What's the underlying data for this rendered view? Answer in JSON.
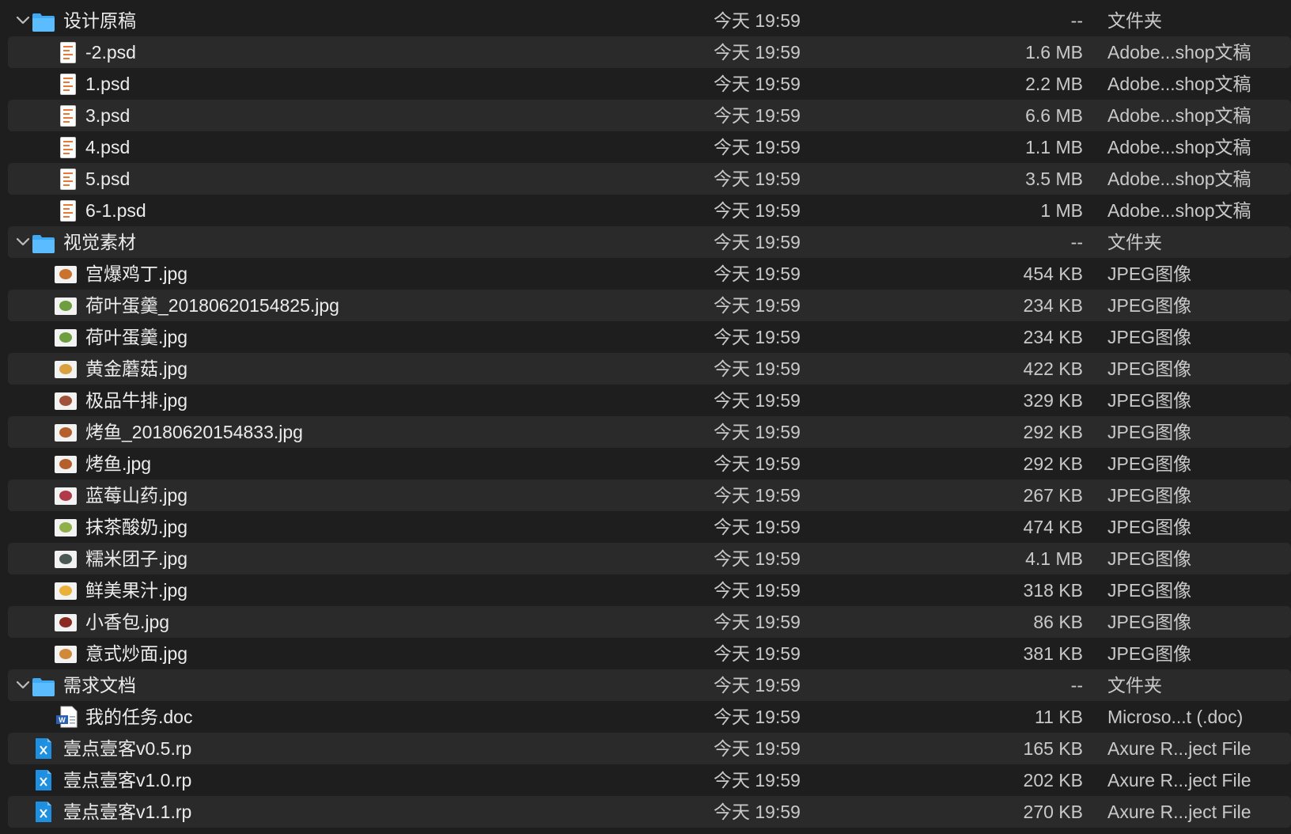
{
  "rows": [
    {
      "name": "设计原稿",
      "date": "今天 19:59",
      "size": "--",
      "kind": "文件夹",
      "icon": "folder-icon",
      "level": 0,
      "expanded": true
    },
    {
      "name": "-2.psd",
      "date": "今天 19:59",
      "size": "1.6 MB",
      "kind": "Adobe...shop文稿",
      "icon": "psd-file-icon",
      "level": 1
    },
    {
      "name": "1.psd",
      "date": "今天 19:59",
      "size": "2.2 MB",
      "kind": "Adobe...shop文稿",
      "icon": "psd-file-icon",
      "level": 1
    },
    {
      "name": "3.psd",
      "date": "今天 19:59",
      "size": "6.6 MB",
      "kind": "Adobe...shop文稿",
      "icon": "psd-file-icon",
      "level": 1
    },
    {
      "name": "4.psd",
      "date": "今天 19:59",
      "size": "1.1 MB",
      "kind": "Adobe...shop文稿",
      "icon": "psd-file-icon",
      "level": 1
    },
    {
      "name": "5.psd",
      "date": "今天 19:59",
      "size": "3.5 MB",
      "kind": "Adobe...shop文稿",
      "icon": "psd-file-icon",
      "level": 1
    },
    {
      "name": "6-1.psd",
      "date": "今天 19:59",
      "size": "1 MB",
      "kind": "Adobe...shop文稿",
      "icon": "psd-file-icon",
      "level": 1
    },
    {
      "name": "视觉素材",
      "date": "今天 19:59",
      "size": "--",
      "kind": "文件夹",
      "icon": "folder-icon",
      "level": 0,
      "expanded": true
    },
    {
      "name": "宫爆鸡丁.jpg",
      "date": "今天 19:59",
      "size": "454 KB",
      "kind": "JPEG图像",
      "icon": "jpeg-thumbnail-icon",
      "level": 1,
      "tint": "#c9732f"
    },
    {
      "name": "荷叶蛋羹_20180620154825.jpg",
      "date": "今天 19:59",
      "size": "234 KB",
      "kind": "JPEG图像",
      "icon": "jpeg-thumbnail-icon",
      "level": 1,
      "tint": "#6e9e3f"
    },
    {
      "name": "荷叶蛋羹.jpg",
      "date": "今天 19:59",
      "size": "234 KB",
      "kind": "JPEG图像",
      "icon": "jpeg-thumbnail-icon",
      "level": 1,
      "tint": "#6e9e3f"
    },
    {
      "name": "黄金蘑菇.jpg",
      "date": "今天 19:59",
      "size": "422 KB",
      "kind": "JPEG图像",
      "icon": "jpeg-thumbnail-icon",
      "level": 1,
      "tint": "#d9a040"
    },
    {
      "name": "极品牛排.jpg",
      "date": "今天 19:59",
      "size": "329 KB",
      "kind": "JPEG图像",
      "icon": "jpeg-thumbnail-icon",
      "level": 1,
      "tint": "#a0523a"
    },
    {
      "name": "烤鱼_20180620154833.jpg",
      "date": "今天 19:59",
      "size": "292 KB",
      "kind": "JPEG图像",
      "icon": "jpeg-thumbnail-icon",
      "level": 1,
      "tint": "#b5602c"
    },
    {
      "name": "烤鱼.jpg",
      "date": "今天 19:59",
      "size": "292 KB",
      "kind": "JPEG图像",
      "icon": "jpeg-thumbnail-icon",
      "level": 1,
      "tint": "#b5602c"
    },
    {
      "name": "蓝莓山药.jpg",
      "date": "今天 19:59",
      "size": "267 KB",
      "kind": "JPEG图像",
      "icon": "jpeg-thumbnail-icon",
      "level": 1,
      "tint": "#b03a4a"
    },
    {
      "name": "抹茶酸奶.jpg",
      "date": "今天 19:59",
      "size": "474 KB",
      "kind": "JPEG图像",
      "icon": "jpeg-thumbnail-icon",
      "level": 1,
      "tint": "#8fb04a"
    },
    {
      "name": "糯米团子.jpg",
      "date": "今天 19:59",
      "size": "4.1 MB",
      "kind": "JPEG图像",
      "icon": "jpeg-thumbnail-icon",
      "level": 1,
      "tint": "#4a5a52"
    },
    {
      "name": "鲜美果汁.jpg",
      "date": "今天 19:59",
      "size": "318 KB",
      "kind": "JPEG图像",
      "icon": "jpeg-thumbnail-icon",
      "level": 1,
      "tint": "#e8b23a"
    },
    {
      "name": "小香包.jpg",
      "date": "今天 19:59",
      "size": "86 KB",
      "kind": "JPEG图像",
      "icon": "jpeg-thumbnail-icon",
      "level": 1,
      "tint": "#8a2a22"
    },
    {
      "name": "意式炒面.jpg",
      "date": "今天 19:59",
      "size": "381 KB",
      "kind": "JPEG图像",
      "icon": "jpeg-thumbnail-icon",
      "level": 1,
      "tint": "#d08a3a"
    },
    {
      "name": "需求文档",
      "date": "今天 19:59",
      "size": "--",
      "kind": "文件夹",
      "icon": "folder-icon",
      "level": 0,
      "expanded": true
    },
    {
      "name": "我的任务.doc",
      "date": "今天 19:59",
      "size": "11 KB",
      "kind": "Microso...t (.doc)",
      "icon": "word-doc-icon",
      "level": 1
    },
    {
      "name": "壹点壹客v0.5.rp",
      "date": "今天 19:59",
      "size": "165 KB",
      "kind": "Axure R...ject File",
      "icon": "axure-file-icon",
      "level": 0
    },
    {
      "name": "壹点壹客v1.0.rp",
      "date": "今天 19:59",
      "size": "202 KB",
      "kind": "Axure R...ject File",
      "icon": "axure-file-icon",
      "level": 0
    },
    {
      "name": "壹点壹客v1.1.rp",
      "date": "今天 19:59",
      "size": "270 KB",
      "kind": "Axure R...ject File",
      "icon": "axure-file-icon",
      "level": 0
    }
  ],
  "colors": {
    "background": "#1e1e1e",
    "alt_row": "#2a2a2a",
    "folder": "#3fa9f5",
    "axure": "#1f8fe0",
    "word": "#2b5fb4"
  }
}
